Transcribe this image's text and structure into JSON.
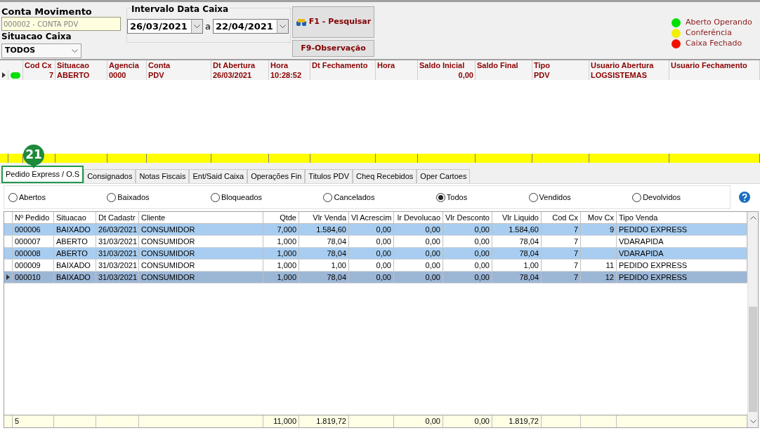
{
  "filters": {
    "conta_label": "Conta Movimento",
    "conta_value": "000002 - CONTA PDV",
    "situacao_label": "Situacao Caixa",
    "situacao_value": "TODOS",
    "intervalo_label": "Intervalo Data Caixa",
    "date_from": "26/03/2021",
    "separator": "a",
    "date_to": "22/04/2021"
  },
  "buttons": [
    {
      "label": "F1 - Pesquisar",
      "kind": "search"
    },
    {
      "label": "F9-Observação",
      "kind": "plain"
    }
  ],
  "legend": [
    {
      "label": "Aberto Operando",
      "color": "#00e000"
    },
    {
      "label": "Conferência",
      "color": "#f0f000"
    },
    {
      "label": "Caixa Fechado",
      "color": "#f01000"
    }
  ],
  "caixa_table": {
    "columns": [
      "Cod Cx",
      "Situacao",
      "Agencia",
      "Conta",
      "Dt Abertura",
      "Hora",
      "Dt Fechamento",
      "Hora",
      "Saldo Inicial",
      "Saldo Final",
      "Tipo",
      "Usuario Abertura",
      "Usuario Fechamento"
    ],
    "rows": [
      {
        "color": "#00e000",
        "current": true,
        "cells": [
          "7",
          "ABERTO",
          "0000",
          "PDV",
          "26/03/2021",
          "10:28:52",
          "",
          "",
          "0,00",
          "",
          "PDV",
          "LOGSISTEMAS",
          ""
        ]
      }
    ]
  },
  "badge": "21",
  "tabs": [
    {
      "label": "Pedido Express / O.S",
      "selected": true
    },
    {
      "label": "Consignados",
      "selected": false
    },
    {
      "label": "Notas Fiscais",
      "selected": false
    },
    {
      "label": "Ent/Said Caixa",
      "selected": false
    },
    {
      "label": "Operações Fin",
      "selected": false
    },
    {
      "label": "Titulos PDV",
      "selected": false
    },
    {
      "label": "Cheq Recebidos",
      "selected": false
    },
    {
      "label": "Oper Cartoes",
      "selected": false
    }
  ],
  "radios": [
    {
      "label": "Abertos",
      "selected": false
    },
    {
      "label": "Baixados",
      "selected": false
    },
    {
      "label": "Bloqueados",
      "selected": false
    },
    {
      "label": "Cancelados",
      "selected": false
    },
    {
      "label": "Todos",
      "selected": true
    },
    {
      "label": "Vendidos",
      "selected": false
    },
    {
      "label": "Devolvidos",
      "selected": false
    }
  ],
  "pedidos_table": {
    "columns": [
      "Nº Pedido",
      "Situacao",
      "Dt Cadastr",
      "Cliente",
      "Qtde",
      "Vlr Venda",
      "Vl Acrescim",
      "lr Devolucao",
      "Vlr Desconto",
      "Vlr Liquido",
      "Cod Cx",
      "Mov Cx",
      "Tipo Venda"
    ],
    "rows": [
      {
        "selected": true,
        "current": false,
        "cells": [
          "000006",
          "BAIXADO",
          "26/03/2021",
          "CONSUMIDOR",
          "7,000",
          "1.584,60",
          "0,00",
          "0,00",
          "0,00",
          "1.584,60",
          "7",
          "9",
          "PEDIDO EXPRESS"
        ]
      },
      {
        "selected": false,
        "current": false,
        "cells": [
          "000007",
          "ABERTO",
          "31/03/2021",
          "CONSUMIDOR",
          "1,000",
          "78,04",
          "0,00",
          "0,00",
          "0,00",
          "78,04",
          "7",
          "",
          "VDARAPIDA"
        ]
      },
      {
        "selected": true,
        "current": false,
        "cells": [
          "000008",
          "ABERTO",
          "31/03/2021",
          "CONSUMIDOR",
          "1,000",
          "78,04",
          "0,00",
          "0,00",
          "0,00",
          "78,04",
          "7",
          "",
          "VDARAPIDA"
        ]
      },
      {
        "selected": false,
        "current": false,
        "cells": [
          "000009",
          "BAIXADO",
          "31/03/2021",
          "CONSUMIDOR",
          "1,000",
          "1,00",
          "0,00",
          "0,00",
          "0,00",
          "1,00",
          "7",
          "11",
          "PEDIDO EXPRESS"
        ]
      },
      {
        "selected": true,
        "current": true,
        "cells": [
          "000010",
          "BAIXADO",
          "31/03/2021",
          "CONSUMIDOR",
          "1,000",
          "78,04",
          "0,00",
          "0,00",
          "0,00",
          "78,04",
          "7",
          "12",
          "PEDIDO EXPRESS"
        ]
      }
    ],
    "totals": {
      "pedido_count": "5",
      "qtde": "11,000",
      "vlr_venda": "1.819,72",
      "vlr_devolucao": "0,00",
      "vlr_desconto": "0,00",
      "vlr_liquido": "1.819,72"
    }
  }
}
